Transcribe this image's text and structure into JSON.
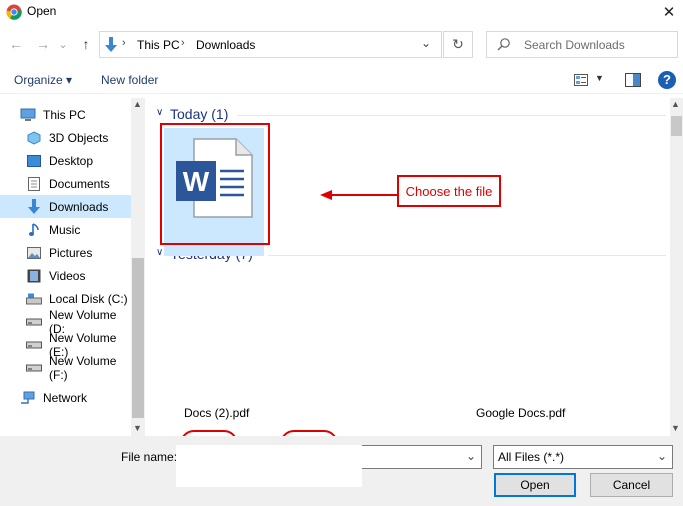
{
  "window": {
    "title": "Open",
    "close_glyph": "✕"
  },
  "nav": {
    "back": "←",
    "forward": "→",
    "recent": "⌄",
    "up": "↑",
    "breadcrumb": [
      "This PC",
      "Downloads"
    ],
    "refresh": "↻",
    "dropdown": "⌄"
  },
  "search": {
    "placeholder": "Search Downloads"
  },
  "toolbar": {
    "organize": "Organize ▾",
    "new_folder": "New folder"
  },
  "sidebar": {
    "items": [
      {
        "label": "This PC",
        "icon": "pc-icon"
      },
      {
        "label": "3D Objects",
        "icon": "cube-icon"
      },
      {
        "label": "Desktop",
        "icon": "desktop-icon"
      },
      {
        "label": "Documents",
        "icon": "documents-icon"
      },
      {
        "label": "Downloads",
        "icon": "download-icon",
        "selected": true
      },
      {
        "label": "Music",
        "icon": "music-icon"
      },
      {
        "label": "Pictures",
        "icon": "pictures-icon"
      },
      {
        "label": "Videos",
        "icon": "videos-icon"
      },
      {
        "label": "Local Disk (C:)",
        "icon": "disk-icon"
      },
      {
        "label": "New Volume (D:",
        "icon": "drive-icon"
      },
      {
        "label": "New Volume (E:)",
        "icon": "drive-icon"
      },
      {
        "label": "New Volume (F:)",
        "icon": "drive-icon"
      },
      {
        "label": "Network",
        "icon": "network-icon"
      }
    ]
  },
  "groups": [
    {
      "title": "Today (1)"
    },
    {
      "title": "Yesterday (7)"
    }
  ],
  "files": {
    "today_file_icon": "word-document-icon",
    "yesterday": [
      "Docs (2).pdf",
      "Google Docs.pdf"
    ]
  },
  "annotation": {
    "label": "Choose the file",
    "color": "#e00000"
  },
  "bottom": {
    "file_name_label": "File name:",
    "file_name_value": "",
    "file_type": "All Files (*.*)",
    "open": "Open",
    "cancel": "Cancel"
  },
  "colors": {
    "selection": "#cce8ff",
    "word_blue": "#2b579a",
    "accent": "#0078d7"
  }
}
